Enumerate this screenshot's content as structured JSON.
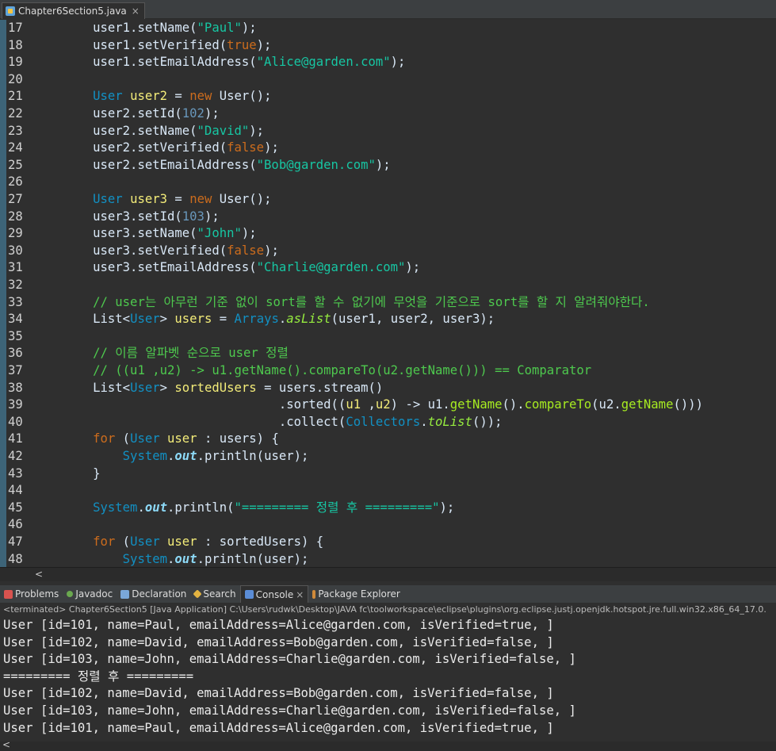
{
  "editor_tab": {
    "title": "Chapter6Section5.java",
    "close": "×"
  },
  "code_lines": [
    {
      "n": "17",
      "seg": [
        [
          "",
          "        "
        ],
        [
          "",
          "user1.setName("
        ],
        [
          "s",
          "\"Paul\""
        ],
        [
          "",
          "); "
        ]
      ]
    },
    {
      "n": "18",
      "seg": [
        [
          "",
          "        "
        ],
        [
          "",
          "user1.setVerified("
        ],
        [
          "k",
          "true"
        ],
        [
          "",
          ");"
        ]
      ]
    },
    {
      "n": "19",
      "seg": [
        [
          "",
          "        "
        ],
        [
          "",
          "user1.setEmailAddress("
        ],
        [
          "s",
          "\"Alice@garden.com\""
        ],
        [
          "",
          ");"
        ]
      ]
    },
    {
      "n": "20",
      "seg": []
    },
    {
      "n": "21",
      "seg": [
        [
          "",
          "        "
        ],
        [
          "t",
          "User"
        ],
        [
          "",
          " "
        ],
        [
          "v",
          "user2"
        ],
        [
          "",
          " = "
        ],
        [
          "k",
          "new"
        ],
        [
          "",
          " User();"
        ]
      ]
    },
    {
      "n": "22",
      "seg": [
        [
          "",
          "        "
        ],
        [
          "",
          "user2.setId("
        ],
        [
          "n",
          "102"
        ],
        [
          "",
          ");"
        ]
      ]
    },
    {
      "n": "23",
      "seg": [
        [
          "",
          "        "
        ],
        [
          "",
          "user2.setName("
        ],
        [
          "s",
          "\"David\""
        ],
        [
          "",
          ");"
        ]
      ]
    },
    {
      "n": "24",
      "seg": [
        [
          "",
          "        "
        ],
        [
          "",
          "user2.setVerified("
        ],
        [
          "k",
          "false"
        ],
        [
          "",
          ");"
        ]
      ]
    },
    {
      "n": "25",
      "seg": [
        [
          "",
          "        "
        ],
        [
          "",
          "user2.setEmailAddress("
        ],
        [
          "s",
          "\"Bob@garden.com\""
        ],
        [
          "",
          ");"
        ]
      ]
    },
    {
      "n": "26",
      "seg": []
    },
    {
      "n": "27",
      "seg": [
        [
          "",
          "        "
        ],
        [
          "t",
          "User"
        ],
        [
          "",
          " "
        ],
        [
          "v",
          "user3"
        ],
        [
          "",
          " = "
        ],
        [
          "k",
          "new"
        ],
        [
          "",
          " User();"
        ]
      ]
    },
    {
      "n": "28",
      "seg": [
        [
          "",
          "        "
        ],
        [
          "",
          "user3.setId("
        ],
        [
          "n",
          "103"
        ],
        [
          "",
          ");"
        ]
      ]
    },
    {
      "n": "29",
      "seg": [
        [
          "",
          "        "
        ],
        [
          "",
          "user3.setName("
        ],
        [
          "s",
          "\"John\""
        ],
        [
          "",
          ");"
        ]
      ]
    },
    {
      "n": "30",
      "seg": [
        [
          "",
          "        "
        ],
        [
          "",
          "user3.setVerified("
        ],
        [
          "k",
          "false"
        ],
        [
          "",
          ");"
        ]
      ]
    },
    {
      "n": "31",
      "seg": [
        [
          "",
          "        "
        ],
        [
          "",
          "user3.setEmailAddress("
        ],
        [
          "s",
          "\"Charlie@garden.com\""
        ],
        [
          "",
          ");"
        ]
      ]
    },
    {
      "n": "32",
      "seg": []
    },
    {
      "n": "33",
      "seg": [
        [
          "",
          "        "
        ],
        [
          "c",
          "// user는 아무런 기준 없이 sort를 할 수 없기에 무엇을 기준으로 sort를 할 지 알려줘야한다."
        ]
      ]
    },
    {
      "n": "34",
      "seg": [
        [
          "",
          "        "
        ],
        [
          "",
          "List<"
        ],
        [
          "t",
          "User"
        ],
        [
          "",
          "> "
        ],
        [
          "v",
          "users"
        ],
        [
          "",
          " = "
        ],
        [
          "t",
          "Arrays"
        ],
        [
          "",
          "."
        ],
        [
          "sm",
          "asList"
        ],
        [
          "",
          "(user1, user2, user3);"
        ]
      ]
    },
    {
      "n": "35",
      "seg": []
    },
    {
      "n": "36",
      "seg": [
        [
          "",
          "        "
        ],
        [
          "c",
          "// 이름 알파벳 순으로 user 정렬"
        ]
      ]
    },
    {
      "n": "37",
      "seg": [
        [
          "",
          "        "
        ],
        [
          "c",
          "// ((u1 ,u2) -> u1.getName().compareTo(u2.getName())) == Comparator"
        ]
      ]
    },
    {
      "n": "38",
      "seg": [
        [
          "",
          "        "
        ],
        [
          "",
          "List<"
        ],
        [
          "t",
          "User"
        ],
        [
          "",
          "> "
        ],
        [
          "v",
          "sortedUsers"
        ],
        [
          "",
          " = users.stream()"
        ]
      ]
    },
    {
      "n": "39",
      "seg": [
        [
          "",
          "                                "
        ],
        [
          "",
          " .sorted(("
        ],
        [
          "v",
          "u1"
        ],
        [
          "",
          " ,"
        ],
        [
          "v",
          "u2"
        ],
        [
          "",
          ") -> u1."
        ],
        [
          "m",
          "getName"
        ],
        [
          "",
          "()."
        ],
        [
          "m",
          "compareTo"
        ],
        [
          "",
          "(u2."
        ],
        [
          "m",
          "getName"
        ],
        [
          "",
          "()))"
        ]
      ]
    },
    {
      "n": "40",
      "seg": [
        [
          "",
          "                                "
        ],
        [
          "",
          " .collect("
        ],
        [
          "t",
          "Collectors"
        ],
        [
          "",
          "."
        ],
        [
          "sm",
          "toList"
        ],
        [
          "",
          "());"
        ]
      ]
    },
    {
      "n": "41",
      "seg": [
        [
          "",
          "        "
        ],
        [
          "k",
          "for"
        ],
        [
          "",
          " ("
        ],
        [
          "t",
          "User"
        ],
        [
          "",
          " "
        ],
        [
          "v",
          "user"
        ],
        [
          "",
          " : users) {"
        ]
      ]
    },
    {
      "n": "42",
      "seg": [
        [
          "",
          "            "
        ],
        [
          "t",
          "System"
        ],
        [
          "",
          "."
        ],
        [
          "f",
          "out"
        ],
        [
          "",
          ".println(user);"
        ]
      ]
    },
    {
      "n": "43",
      "seg": [
        [
          "",
          "        "
        ],
        [
          "",
          "}"
        ]
      ]
    },
    {
      "n": "44",
      "seg": []
    },
    {
      "n": "45",
      "seg": [
        [
          "",
          "        "
        ],
        [
          "t",
          "System"
        ],
        [
          "",
          "."
        ],
        [
          "f",
          "out"
        ],
        [
          "",
          ".println("
        ],
        [
          "s",
          "\"========= 정렬 후 =========\""
        ],
        [
          "",
          ");"
        ]
      ]
    },
    {
      "n": "46",
      "seg": []
    },
    {
      "n": "47",
      "seg": [
        [
          "",
          "        "
        ],
        [
          "k",
          "for"
        ],
        [
          "",
          " ("
        ],
        [
          "t",
          "User"
        ],
        [
          "",
          " "
        ],
        [
          "v",
          "user"
        ],
        [
          "",
          " : sortedUsers) {"
        ]
      ]
    },
    {
      "n": "48",
      "seg": [
        [
          "",
          "            "
        ],
        [
          "t",
          "System"
        ],
        [
          "",
          "."
        ],
        [
          "f",
          "out"
        ],
        [
          "",
          ".println(user);"
        ]
      ]
    }
  ],
  "scroll_arrow": "<",
  "panel_tabs": [
    {
      "label": "Problems",
      "icon": "problems-icon",
      "cls": "ico-problems",
      "active": false
    },
    {
      "label": "Javadoc",
      "icon": "javadoc-icon",
      "cls": "ico-javadoc",
      "active": false
    },
    {
      "label": "Declaration",
      "icon": "declaration-icon",
      "cls": "ico-decl",
      "active": false
    },
    {
      "label": "Search",
      "icon": "search-icon",
      "cls": "ico-search",
      "active": false
    },
    {
      "label": "Console",
      "icon": "console-icon",
      "cls": "ico-console",
      "active": true,
      "close": "×"
    },
    {
      "label": "Package Explorer",
      "icon": "package-explorer-icon",
      "cls": "ico-pkg",
      "active": false
    }
  ],
  "console_status": "<terminated> Chapter6Section5 [Java Application] C:\\Users\\rudwk\\Desktop\\JAVA fc\\toolworkspace\\eclipse\\plugins\\org.eclipse.justj.openjdk.hotspot.jre.full.win32.x86_64_17.0.",
  "console_lines": [
    "User [id=101, name=Paul, emailAddress=Alice@garden.com, isVerified=true, ]",
    "User [id=102, name=David, emailAddress=Bob@garden.com, isVerified=false, ]",
    "User [id=103, name=John, emailAddress=Charlie@garden.com, isVerified=false, ]",
    "========= 정렬 후 =========",
    "User [id=102, name=David, emailAddress=Bob@garden.com, isVerified=false, ]",
    "User [id=103, name=John, emailAddress=Charlie@garden.com, isVerified=false, ]",
    "User [id=101, name=Paul, emailAddress=Alice@garden.com, isVerified=true, ]"
  ]
}
